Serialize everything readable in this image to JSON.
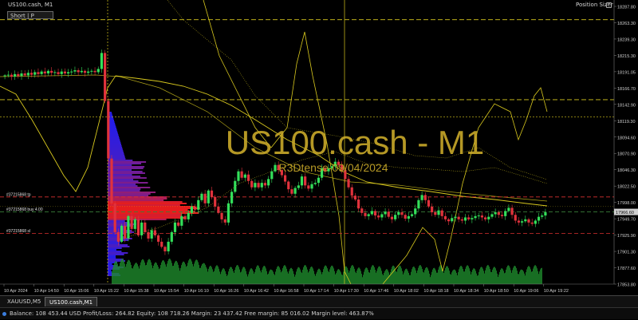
{
  "window": {
    "title": "US100.cash, M1",
    "position_sizer": "Position Sizer"
  },
  "order_box": {
    "label": "Short | P"
  },
  "watermark": {
    "symbol": "US100.cash - M1",
    "author": "R3Dtense-09/04/2024"
  },
  "price_axis": {
    "ticks": [
      "18287.80",
      "18263.30",
      "18239.30",
      "18215.30",
      "18191.05",
      "18166.70",
      "18142.90",
      "18119.30",
      "18094.60",
      "18070.90",
      "18046.30",
      "18022.50",
      "17998.00",
      "17949.70",
      "17925.90",
      "17901.30",
      "17877.60",
      "17853.80"
    ],
    "current_price": "17966.60"
  },
  "time_axis": {
    "ticks": [
      "10 Apr 2024",
      "10 Apr 14:50",
      "10 Apr 15:06",
      "10 Apr 15:22",
      "10 Apr 15:38",
      "10 Apr 15:54",
      "10 Apr 16:10",
      "10 Apr 16:26",
      "10 Apr 16:42",
      "10 Apr 16:58",
      "10 Apr 17:14",
      "10 Apr 17:30",
      "10 Apr 17:46",
      "10 Apr 18:02",
      "10 Apr 18:18",
      "10 Apr 18:34",
      "10 Apr 18:50",
      "10 Apr 19:06",
      "10 Apr 19:22"
    ]
  },
  "order_lines": [
    {
      "label": "#37215868 tp",
      "price": 17990
    },
    {
      "label": "#37215868 buy 4.00",
      "price": 17966.6
    },
    {
      "label": "#37215868 sl",
      "price": 17933
    }
  ],
  "levels": [
    18267,
    18142,
    18115
  ],
  "tabs": [
    {
      "label": "XAUUSD,M5",
      "active": false
    },
    {
      "label": "US100.cash,M1",
      "active": true
    }
  ],
  "status_bar": {
    "text": "Balance: 108 453.44 USD  Profit/Loss: 264.82  Equity: 108 718.26  Margin: 23 437.42  Free margin: 85 016.02  Margin level: 463.87%"
  },
  "colors": {
    "bull": "#33e05a",
    "bear": "#e0323c",
    "indicator": "#d8c81e",
    "watermark": "#c9a92a",
    "volume": "#1e8a2c",
    "profile_blue": "#2a35ff",
    "profile_red": "#ff2020"
  },
  "chart_data": {
    "type": "candlestick",
    "y_range": [
      17853.8,
      18287.8
    ],
    "closes": [
      18180,
      18181,
      18178,
      18182,
      18179,
      18183,
      18180,
      18184,
      18181,
      18185,
      18182,
      18186,
      18183,
      18187,
      18184,
      18185,
      18182,
      18186,
      18183,
      18185,
      18186,
      18188,
      18185,
      18187,
      18184,
      18186,
      18187,
      18185,
      18190,
      18215,
      18140,
      18050,
      17980,
      17935,
      17920,
      17945,
      17925,
      17960,
      17940,
      17955,
      17930,
      17950,
      17935,
      17925,
      17938,
      17930,
      17920,
      17912,
      17905,
      17920,
      17935,
      17950,
      17945,
      17960,
      17955,
      17965,
      17975,
      17970,
      17985,
      17995,
      17980,
      18000,
      17990,
      17975,
      17965,
      17955,
      17950,
      17980,
      17998,
      18015,
      18030,
      18020,
      18025,
      18015,
      18005,
      18012,
      18005,
      18012,
      18008,
      18018,
      18030,
      18040,
      18032,
      18024,
      18014,
      18002,
      17995,
      18004,
      18008,
      18022,
      18008,
      18003,
      18010,
      18012,
      18020,
      18035,
      18030,
      18035,
      18038,
      18045,
      18040,
      18032,
      18018,
      18005,
      17992,
      17986,
      17972,
      17965,
      17960,
      17963,
      17968,
      17961,
      17958,
      17963,
      17967,
      17959,
      17955,
      17962,
      17966,
      17962,
      17956,
      17960,
      17963,
      17972,
      17985,
      17993,
      17985,
      17975,
      17966,
      17962,
      17969,
      17960,
      17955,
      17952,
      17957,
      17959,
      17955,
      17953,
      17958,
      17955,
      17957,
      17960,
      17961,
      17958,
      17955,
      17959,
      17963,
      17966,
      17962,
      17960,
      17968,
      17973,
      17962,
      17953,
      17950,
      17952,
      17955,
      17950,
      17948,
      17953,
      17959,
      17961,
      17966
    ]
  }
}
